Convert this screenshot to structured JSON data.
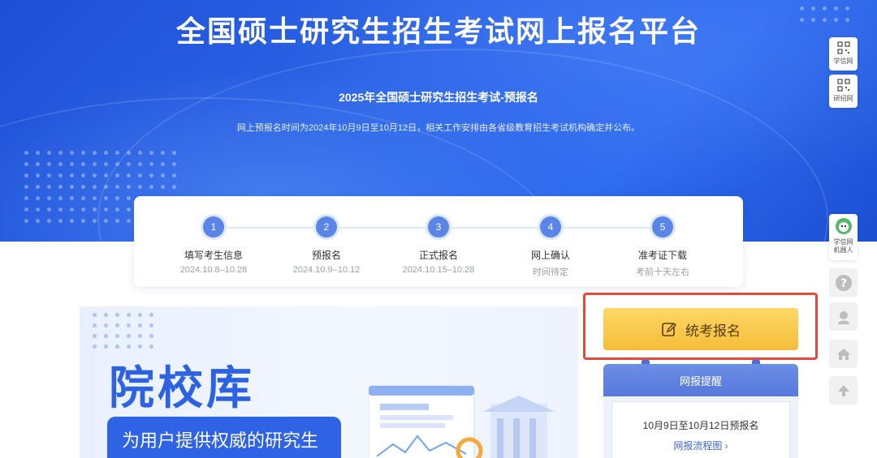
{
  "hero": {
    "title": "全国硕士研究生招生考试网上报名平台",
    "subtitle": "2025年全国硕士研究生招生考试-预报名",
    "note": "网上预报名时间为2024年10月9日至10月12日，相关工作安排由各省级教育招生考试机构确定并公布。"
  },
  "steps": [
    {
      "num": "1",
      "name": "填写考生信息",
      "date": "2024.10.8–10.28"
    },
    {
      "num": "2",
      "name": "预报名",
      "date": "2024.10.9–10.12"
    },
    {
      "num": "3",
      "name": "正式报名",
      "date": "2024.10.15–10.28"
    },
    {
      "num": "4",
      "name": "网上确认",
      "date": "时间待定"
    },
    {
      "num": "5",
      "name": "准考证下载",
      "date": "考前十天左右"
    }
  ],
  "library": {
    "title": "院校库",
    "tagline": "为用户提供权威的研究生"
  },
  "register": {
    "label": "统考报名",
    "icon": "edit-icon"
  },
  "reminder": {
    "title": "网报提醒",
    "date_text": "10月9日至10月12日预报名",
    "link": "网报流程图 ›"
  },
  "sidebar": {
    "xuexin": "学信网",
    "yanzhao": "研招网",
    "robot_line1": "学信网",
    "robot_line2": "机器人"
  },
  "colors": {
    "hero_blue": "#2a63e6",
    "accent_blue": "#2d63e2",
    "button_yellow": "#f5bd3a",
    "highlight_red": "#e24a3b"
  }
}
